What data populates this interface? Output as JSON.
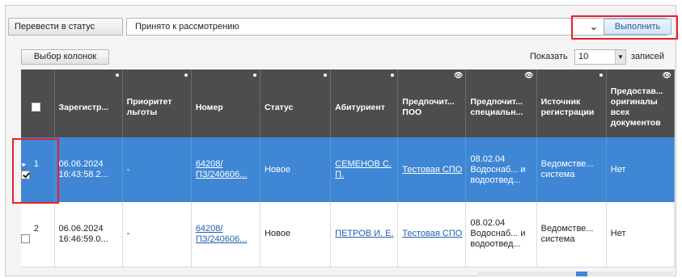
{
  "toolbar": {
    "status_label": "Перевести в статус",
    "status_value": "Принято к рассмотрению",
    "execute_label": "Выполнить",
    "column_select_label": "Выбор колонок",
    "show_label": "Показать",
    "show_value": "10",
    "records_label": "записей"
  },
  "table": {
    "columns": [
      "Зарегистр...",
      "Приоритет льготы",
      "Номер",
      "Статус",
      "Абитуриент",
      "Предпочит... ПОО",
      "Предпочит... специальн...",
      "Источник регистрации",
      "Предостав... оригиналы всех документов"
    ],
    "rows": [
      {
        "num": "1",
        "checked": true,
        "selected": true,
        "registered": "06.06.2024 16:43:58.2...",
        "priority": "-",
        "number": "64208/ ПЗ/240606...",
        "status": "Новое",
        "applicant": "СЕМЕНОВ С. П.",
        "poo": "Тестовая СПО",
        "specialty": "08.02.04 Водоснаб... и водоотвед...",
        "source": "Ведомстве... система",
        "originals": "Нет"
      },
      {
        "num": "2",
        "checked": false,
        "selected": false,
        "registered": "06.06.2024 16:46:59.0...",
        "priority": "-",
        "number": "64208/ ПЗ/240606...",
        "status": "Новое",
        "applicant": "ПЕТРОВ И. Е.",
        "poo": "Тестовая СПО",
        "specialty": "08.02.04 Водоснаб... и водоотвед...",
        "source": "Ведомстве... система",
        "originals": "Нет"
      }
    ]
  },
  "icons": {
    "dropdown": "chevron-down-icon",
    "column_settings": "dot-icon",
    "visibility": "eye-icon"
  },
  "colors": {
    "header_bg": "#4d4d4d",
    "selected_row_bg": "#3f87d5",
    "highlight_border": "#e8202a",
    "link": "#1f5fb0"
  }
}
